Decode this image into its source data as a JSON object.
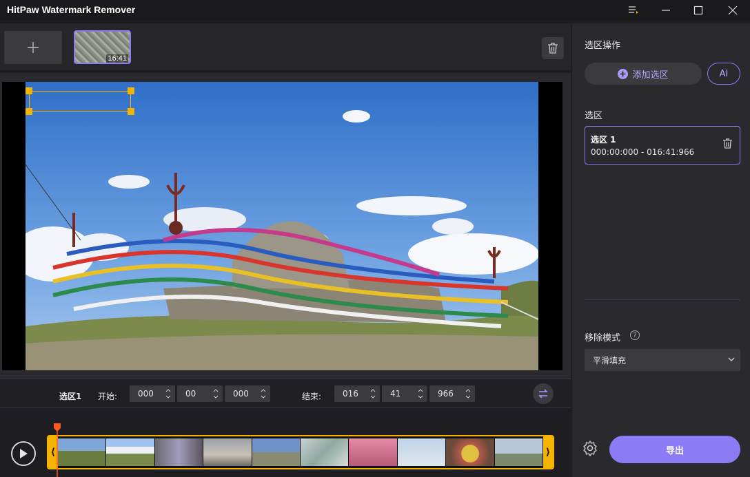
{
  "app": {
    "title": "HitPaw Watermark Remover"
  },
  "window_controls": [
    "menu-icon",
    "minimize-icon",
    "maximize-icon",
    "close-icon"
  ],
  "media": {
    "add_icon": "plus-icon",
    "thumb_duration": "16:41",
    "delete_icon": "trash-icon"
  },
  "controls": {
    "region_label": "选区1",
    "start_label": "开始:",
    "start": [
      "000",
      "00",
      "000"
    ],
    "end_label": "结束:",
    "end": [
      "016",
      "41",
      "966"
    ],
    "swap_icon": "swap-icon"
  },
  "sidebar": {
    "ops_title": "选区操作",
    "add_region_label": "添加选区",
    "ai_label": "AI",
    "regions_title": "选区",
    "regions": [
      {
        "name": "选区 1",
        "time": "000:00:000 - 016:41:966"
      }
    ],
    "mode_title": "移除模式",
    "mode_help": "?",
    "mode_value": "平滑填充",
    "export_label": "导出"
  },
  "timeline": {
    "grip_left": "⟨",
    "grip_right": "⟩"
  },
  "colors": {
    "accent": "#8b7cf6",
    "selection": "#f5b400",
    "playhead": "#ff5a1f"
  }
}
